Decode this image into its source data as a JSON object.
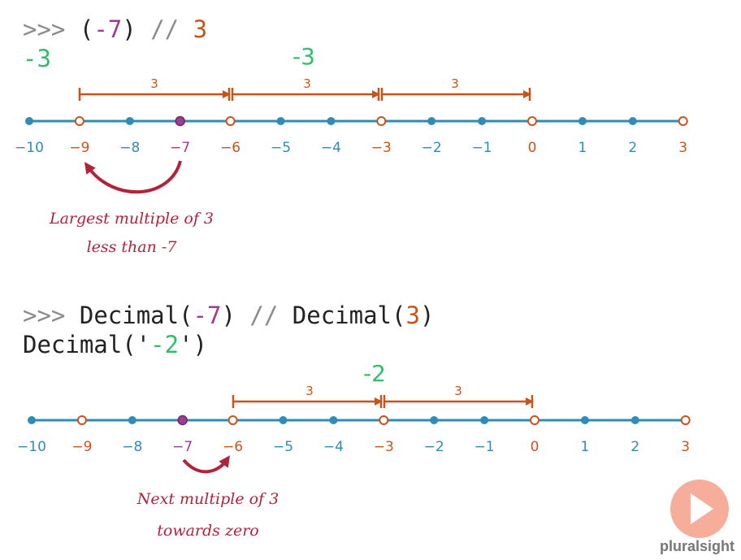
{
  "example1": {
    "prompt": ">>>",
    "open_paren": "(",
    "neg_seven": "-7",
    "close_paren": ")",
    "operator": "//",
    "divisor": "3",
    "result": "-3",
    "result_large": "-3",
    "span_labels": [
      "3",
      "3",
      "3"
    ],
    "annotation_line1": "Largest multiple of 3",
    "annotation_line2": "less than -7"
  },
  "example2": {
    "prompt": ">>>",
    "decimal_open": "Decimal(",
    "neg_seven": "-7",
    "close_paren": ")",
    "operator": "//",
    "decimal_open2": "Decimal(",
    "divisor": "3",
    "close_paren2": ")",
    "result_prefix": "Decimal('",
    "result_value": "-2",
    "result_suffix": "')",
    "result_large": "-2",
    "span_labels": [
      "3",
      "3"
    ],
    "annotation_line1": "Next multiple of 3",
    "annotation_line2": "towards zero"
  },
  "number_line": {
    "ticks": [
      "−10",
      "−9",
      "−8",
      "−7",
      "−6",
      "−5",
      "−4",
      "−3",
      "−2",
      "−1",
      "0",
      "1",
      "2",
      "3"
    ],
    "values": [
      -10,
      -9,
      -8,
      -7,
      -6,
      -5,
      -4,
      -3,
      -2,
      -1,
      0,
      1,
      2,
      3
    ],
    "multiples_of_3": [
      -9,
      -6,
      -3,
      0,
      3
    ],
    "highlight": -7
  },
  "colors": {
    "line": "#2f8db5",
    "multiple": "#c9541a",
    "highlight": "#9c3d8f",
    "result": "#2fbf6a",
    "annotation": "#b0233b"
  },
  "branding": {
    "logo_text": "pluralsight",
    "logo_icon": "play-icon"
  }
}
